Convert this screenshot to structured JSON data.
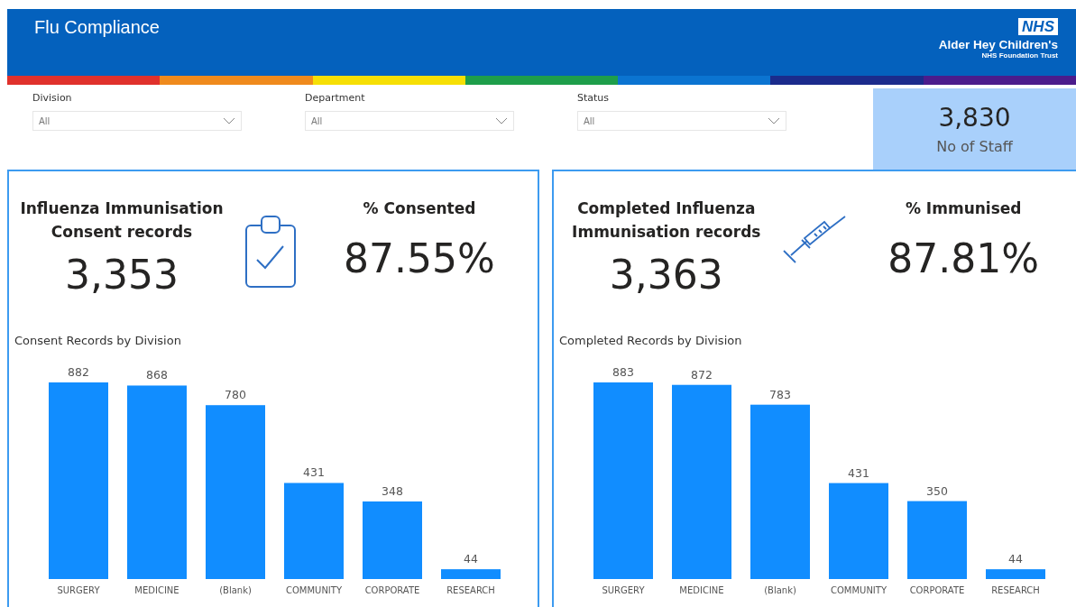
{
  "header": {
    "title": "Flu Compliance",
    "logo": {
      "badge": "NHS",
      "name": "Alder Hey Children's",
      "subtitle": "NHS Foundation Trust"
    }
  },
  "filters": [
    {
      "label": "Division",
      "value": "All"
    },
    {
      "label": "Department",
      "value": "All"
    },
    {
      "label": "Status",
      "value": "All"
    }
  ],
  "staff_card": {
    "value": "3,830",
    "label": "No of Staff"
  },
  "panels": [
    {
      "kind": "clipboard",
      "count_title": "Influenza Immunisation Consent records",
      "count": "3,353",
      "pct_title": "% Consented",
      "pct": "87.55%",
      "chart_data": {
        "type": "bar",
        "title": "Consent Records by Division",
        "categories": [
          "SURGERY",
          "MEDICINE",
          "(Blank)",
          "COMMUNITY",
          "CORPORATE",
          "RESEARCH"
        ],
        "values": [
          882,
          868,
          780,
          431,
          348,
          44
        ],
        "data_labels": true
      }
    },
    {
      "kind": "syringe",
      "count_title": "Completed Influenza Immunisation records",
      "count": "3,363",
      "pct_title": "% Immunised",
      "pct": "87.81%",
      "chart_data": {
        "type": "bar",
        "title": "Completed Records by Division",
        "categories": [
          "SURGERY",
          "MEDICINE",
          "(Blank)",
          "COMMUNITY",
          "CORPORATE",
          "RESEARCH"
        ],
        "values": [
          883,
          872,
          783,
          431,
          350,
          44
        ],
        "data_labels": true
      }
    }
  ]
}
